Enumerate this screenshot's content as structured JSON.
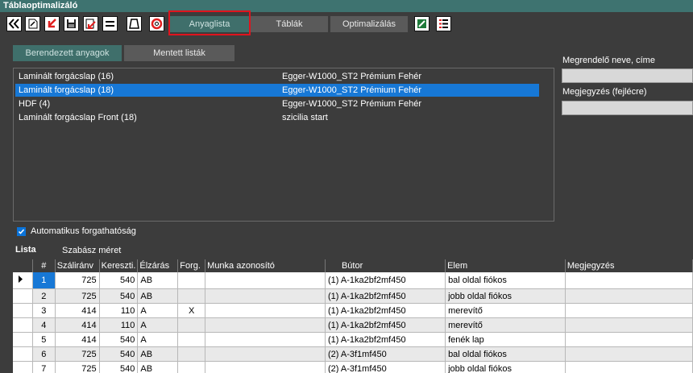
{
  "window": {
    "title": "Táblaoptimalizáló"
  },
  "toolbar": {
    "tabs": [
      {
        "label": "Anyaglista",
        "active": true
      },
      {
        "label": "Táblák",
        "active": false
      },
      {
        "label": "Optimalizálás",
        "active": false
      }
    ],
    "icons": [
      "double-chevron-left-icon",
      "edit-document-icon",
      "import-arrow-icon",
      "save-icon",
      "export-arrow-icon",
      "equals-icon",
      "trapezoid-icon",
      "lifebuoy-icon",
      "excel-export-icon",
      "list-icon"
    ]
  },
  "panel_tabs": [
    {
      "label": "Berendezett anyagok",
      "active": true
    },
    {
      "label": "Mentett listák",
      "active": false
    }
  ],
  "materials": [
    {
      "name": "Laminált forgácslap (16)",
      "decor": "Egger-W1000_ST2 Prémium Fehér",
      "selected": false
    },
    {
      "name": "Laminált forgácslap (18)",
      "decor": "Egger-W1000_ST2 Prémium Fehér",
      "selected": true
    },
    {
      "name": "HDF (4)",
      "decor": "Egger-W1000_ST2 Prémium Fehér",
      "selected": false
    },
    {
      "name": "Laminált forgácslap Front (18)",
      "decor": "szicilia start",
      "selected": false
    }
  ],
  "right_panel": {
    "customer_label": "Megrendelő neve, címe",
    "customer_value": "",
    "note_label": "Megjegyzés (fejlécre)",
    "note_value": ""
  },
  "auto_rotate": {
    "label": "Automatikus forgathatóság",
    "checked": true
  },
  "list_section": {
    "title": "Lista",
    "subtitle": "Szabász méret"
  },
  "grid": {
    "columns": [
      "#",
      "Száliránv",
      "Kereszti.",
      "Élzárás",
      "Forg.",
      "Munka azonosító",
      "Bútor",
      "Elem",
      "Megjegyzés"
    ],
    "rows": [
      [
        "1",
        "725",
        "540",
        "AB",
        "",
        "",
        "(1) A-1ka2bf2mf450",
        "bal oldal fiókos",
        ""
      ],
      [
        "2",
        "725",
        "540",
        "AB",
        "",
        "",
        "(1) A-1ka2bf2mf450",
        "jobb oldal fiókos",
        ""
      ],
      [
        "3",
        "414",
        "110",
        "A",
        "X",
        "",
        "(1) A-1ka2bf2mf450",
        "merevítő",
        ""
      ],
      [
        "4",
        "414",
        "110",
        "A",
        "",
        "",
        "(1) A-1ka2bf2mf450",
        "merevítő",
        ""
      ],
      [
        "5",
        "414",
        "540",
        "A",
        "",
        "",
        "(1) A-1ka2bf2mf450",
        "fenék lap",
        ""
      ],
      [
        "6",
        "725",
        "540",
        "AB",
        "",
        "",
        "(2) A-3f1mf450",
        "bal oldal fiókos",
        ""
      ],
      [
        "7",
        "725",
        "540",
        "AB",
        "",
        "",
        "(2) A-3f1mf450",
        "jobb oldal fiókos",
        ""
      ]
    ],
    "selected_row": 1
  },
  "colors": {
    "accent": "#3e7370",
    "selection": "#1778d6",
    "highlight_box": "#e0141e"
  }
}
